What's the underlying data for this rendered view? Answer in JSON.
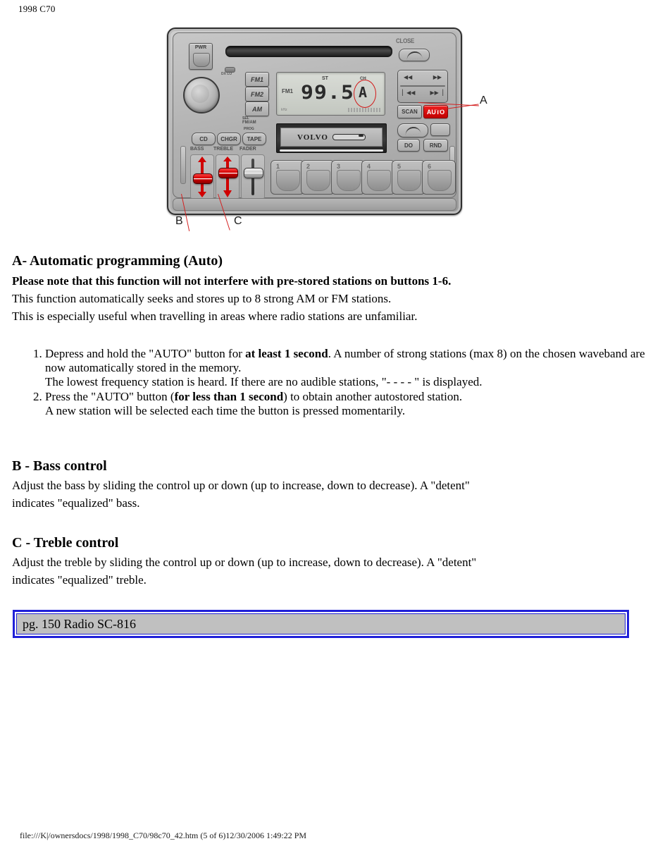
{
  "header": {
    "model_year": "1998 C70"
  },
  "figure": {
    "radio": {
      "power_button": "PWR",
      "close_label": "CLOSE",
      "led_label": "DX LO",
      "band_buttons": [
        {
          "label": "FM1",
          "name": "fm1"
        },
        {
          "label": "FM2",
          "name": "fm2"
        },
        {
          "label": "AM",
          "name": "am"
        }
      ],
      "seek_label": "SEL",
      "band_sub_label": "FM/AM",
      "lcd": {
        "band": "FM1",
        "stereo": "ST",
        "frequency": "99.5",
        "channel_label": "CH",
        "auto_indicator": "A",
        "mini_label": "kHz"
      },
      "scan_button": "SCAN",
      "auto_button": "AUTO",
      "source_buttons": [
        {
          "label": "CD",
          "name": "cd"
        },
        {
          "label": "CHGR",
          "name": "chgr"
        },
        {
          "label": "TAPE",
          "name": "tape"
        }
      ],
      "prog_label": "PROG",
      "tone_labels": [
        {
          "label": "BASS",
          "name": "bass"
        },
        {
          "label": "TREBLE",
          "name": "treble"
        },
        {
          "label": "FADER",
          "name": "fader"
        }
      ],
      "cassette_brand": "VOLVO",
      "dolby_button": "DO",
      "rnd_button": "RND",
      "preset_buttons": [
        "1",
        "2",
        "3",
        "4",
        "5",
        "6"
      ],
      "seek_glyphs": {
        "rewind": "◀◀",
        "forward": "▶▶",
        "track_prev": "▏◀◀",
        "track_next": "▶▶▕"
      }
    },
    "callouts": [
      {
        "label": "A",
        "name": "callout-a"
      },
      {
        "label": "B",
        "name": "callout-b"
      },
      {
        "label": "C",
        "name": "callout-c"
      }
    ],
    "accent_color": "#d42020"
  },
  "content": {
    "section_a": {
      "title": "A- Automatic programming (Auto)",
      "note": "Please note that this function will not interfere with pre-stored stations on buttons 1-6.",
      "line1": "This function automatically seeks and stores up to 8 strong AM or FM stations.",
      "line2": "This is especially useful when travelling in areas where radio stations are unfamiliar.",
      "steps": [
        {
          "part1": "Depress and hold the \"AUTO\" button for ",
          "bold": "at least 1 second",
          "part2": ". A number of strong stations (max 8) on the chosen waveband are now automatically stored in the memory.",
          "sub": "The lowest frequency station is heard. If there are no audible stations, \"- - - - \" is displayed."
        },
        {
          "part1": "Press the \"AUTO\" button (",
          "bold": "for less than 1 second",
          "part2": ") to obtain another autostored station.",
          "sub": "A new station will be selected each time the button is pressed momentarily."
        }
      ]
    },
    "section_b": {
      "title": "B - Bass control",
      "line1": "Adjust the bass by sliding the control up or down (up to increase, down to decrease). A \"detent\"",
      "line2": "indicates \"equalized\" bass."
    },
    "section_c": {
      "title": "C - Treble control",
      "line1": "Adjust the treble by sliding the control up or down (up to increase, down to decrease). A \"detent\"",
      "line2": "indicates \"equalized\" treble."
    }
  },
  "footer": {
    "page_ref": "pg. 150 Radio SC-816",
    "border_color": "#2020d8",
    "fill_color": "#c0c0c0",
    "file_path": "file:///K|/ownersdocs/1998/1998_C70/98c70_42.htm (5 of 6)12/30/2006 1:49:22 PM"
  }
}
